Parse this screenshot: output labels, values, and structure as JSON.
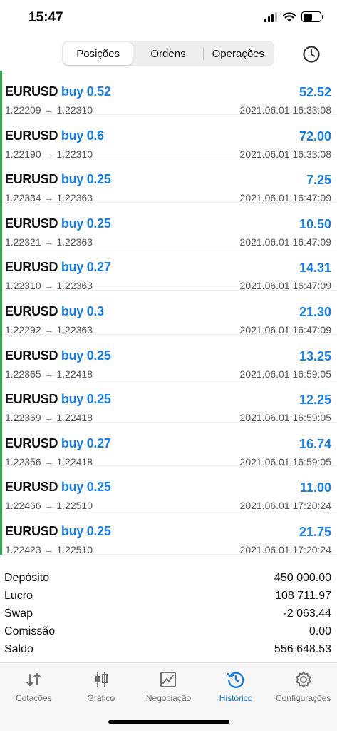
{
  "status_bar": {
    "time": "15:47"
  },
  "segments": [
    {
      "label": "Posições",
      "active": true
    },
    {
      "label": "Ordens",
      "active": false
    },
    {
      "label": "Operações",
      "active": false
    }
  ],
  "trades": [
    {
      "symbol": "EURUSD",
      "side": "buy 0.52",
      "prices": "1.22209 → 1.22310",
      "profit": "52.52",
      "time": "2021.06.01 16:33:08"
    },
    {
      "symbol": "EURUSD",
      "side": "buy 0.6",
      "prices": "1.22190 → 1.22310",
      "profit": "72.00",
      "time": "2021.06.01 16:33:08"
    },
    {
      "symbol": "EURUSD",
      "side": "buy 0.25",
      "prices": "1.22334 → 1.22363",
      "profit": "7.25",
      "time": "2021.06.01 16:47:09"
    },
    {
      "symbol": "EURUSD",
      "side": "buy 0.25",
      "prices": "1.22321 → 1.22363",
      "profit": "10.50",
      "time": "2021.06.01 16:47:09"
    },
    {
      "symbol": "EURUSD",
      "side": "buy 0.27",
      "prices": "1.22310 → 1.22363",
      "profit": "14.31",
      "time": "2021.06.01 16:47:09"
    },
    {
      "symbol": "EURUSD",
      "side": "buy 0.3",
      "prices": "1.22292 → 1.22363",
      "profit": "21.30",
      "time": "2021.06.01 16:47:09"
    },
    {
      "symbol": "EURUSD",
      "side": "buy 0.25",
      "prices": "1.22365 → 1.22418",
      "profit": "13.25",
      "time": "2021.06.01 16:59:05"
    },
    {
      "symbol": "EURUSD",
      "side": "buy 0.25",
      "prices": "1.22369 → 1.22418",
      "profit": "12.25",
      "time": "2021.06.01 16:59:05"
    },
    {
      "symbol": "EURUSD",
      "side": "buy 0.27",
      "prices": "1.22356 → 1.22418",
      "profit": "16.74",
      "time": "2021.06.01 16:59:05"
    },
    {
      "symbol": "EURUSD",
      "side": "buy 0.25",
      "prices": "1.22466 → 1.22510",
      "profit": "11.00",
      "time": "2021.06.01 17:20:24"
    },
    {
      "symbol": "EURUSD",
      "side": "buy 0.25",
      "prices": "1.22423 → 1.22510",
      "profit": "21.75",
      "time": "2021.06.01 17:20:24"
    }
  ],
  "summary": {
    "deposit_label": "Depósito",
    "deposit_value": "450 000.00",
    "profit_label": "Lucro",
    "profit_value": "108 711.97",
    "swap_label": "Swap",
    "swap_value": "-2 063.44",
    "commission_label": "Comissão",
    "commission_value": "0.00",
    "balance_label": "Saldo",
    "balance_value": "556 648.53"
  },
  "tabs": [
    {
      "label": "Cotações",
      "icon": "quotes-arrows-icon",
      "active": false
    },
    {
      "label": "Gráfico",
      "icon": "candlestick-icon",
      "active": false
    },
    {
      "label": "Negociação",
      "icon": "trade-chart-icon",
      "active": false
    },
    {
      "label": "Histórico",
      "icon": "history-clock-icon",
      "active": true
    },
    {
      "label": "Configurações",
      "icon": "gear-icon",
      "active": false
    }
  ],
  "colors": {
    "accent": "#1a7ee3",
    "profit_bar": "#2eaa4a"
  }
}
